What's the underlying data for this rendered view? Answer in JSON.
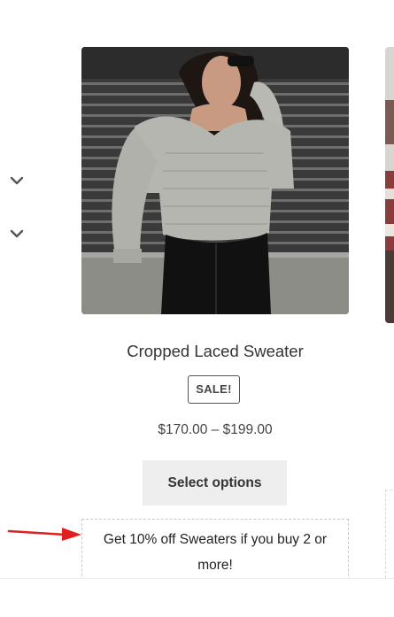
{
  "filters": {
    "chevrons": [
      {
        "icon": "chevron-down-icon"
      },
      {
        "icon": "chevron-down-icon"
      }
    ]
  },
  "product": {
    "title": "Cropped Laced Sweater",
    "sale_badge": "SALE!",
    "price": "$170.00 – $199.00",
    "button_label": "Select options",
    "promo_text": "Get 10% off Sweaters if you buy 2 or more!"
  },
  "annotation": {
    "icon": "red-arrow-icon",
    "color": "#e02020"
  },
  "colors": {
    "button_bg": "#eeeeee",
    "text": "#333333",
    "promo_border": "#c9c9c9"
  }
}
